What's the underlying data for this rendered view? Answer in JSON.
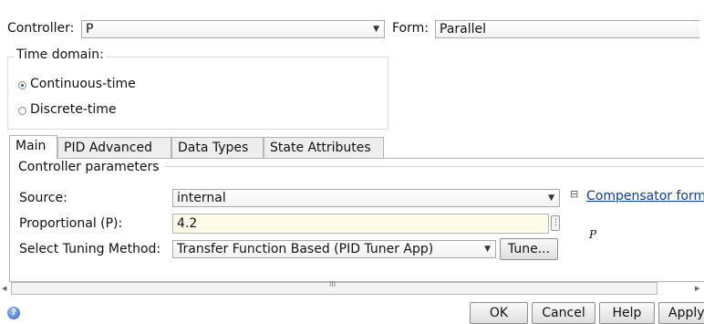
{
  "header": {
    "controller_label": "Controller:",
    "controller_value": "P",
    "form_label": "Form:",
    "form_value": "Parallel"
  },
  "time_domain": {
    "title": "Time domain:",
    "options": [
      {
        "label": "Continuous-time",
        "selected": true
      },
      {
        "label": "Discrete-time",
        "selected": false
      }
    ]
  },
  "tabs": [
    "Main",
    "PID Advanced",
    "Data Types",
    "State Attributes"
  ],
  "main": {
    "section_title": "Controller parameters",
    "source_label": "Source:",
    "source_value": "internal",
    "proportional_label": "Proportional (P):",
    "proportional_value": "4.2",
    "tuning_label": "Select Tuning Method:",
    "tuning_value": "Transfer Function Based (PID Tuner App)",
    "tune_button": "Tune...",
    "compensator_link": "Compensator form",
    "formula_symbol": "P"
  },
  "scrollbar": {
    "thumb_grip": "III"
  },
  "footer": {
    "ok": "OK",
    "cancel": "Cancel",
    "help": "Help",
    "apply": "Apply"
  },
  "icons": {
    "help": "help-icon",
    "collapse": "collapse-icon",
    "scroll_left": "arrow-left-icon",
    "scroll_right": "arrow-right-icon"
  }
}
